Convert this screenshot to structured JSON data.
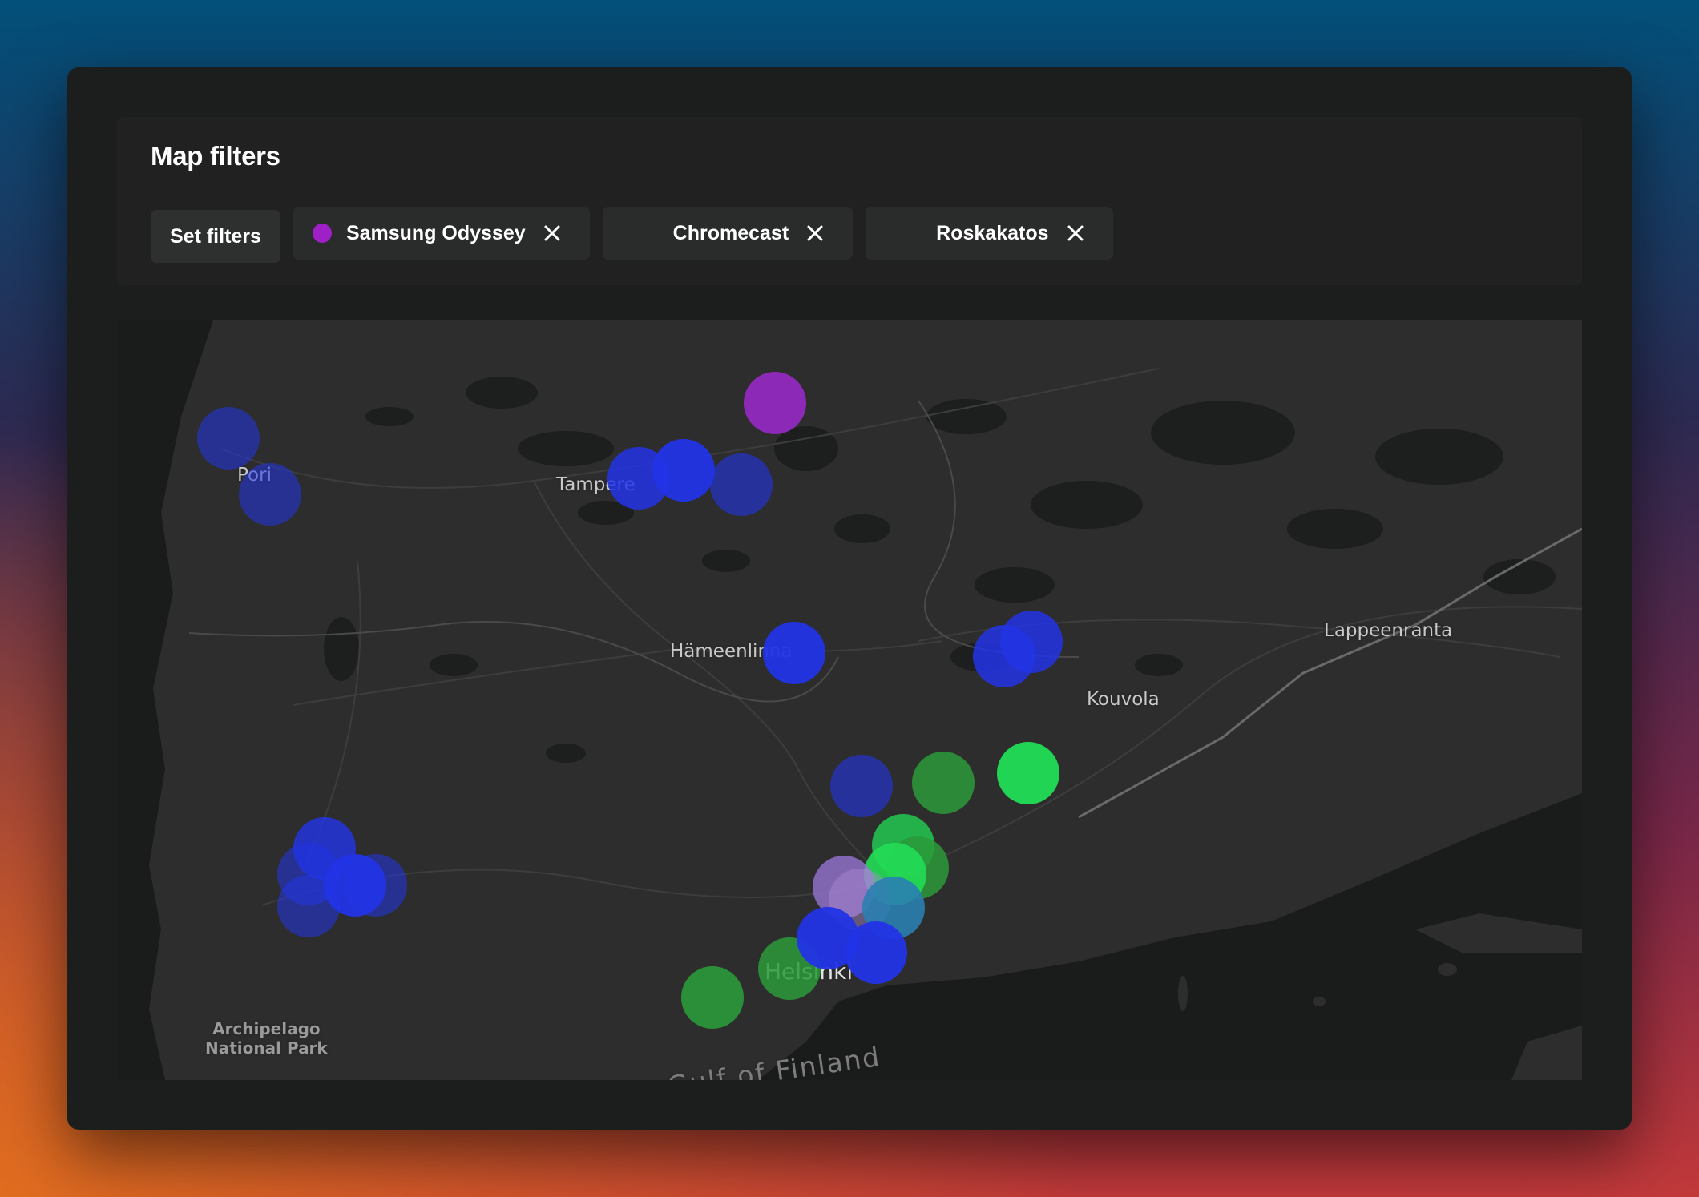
{
  "panel": {
    "title": "Map filters",
    "set_filters_label": "Set filters"
  },
  "filters": [
    {
      "label": "Samsung Odyssey",
      "color": "#a020c8",
      "show_dot": true
    },
    {
      "label": "Chromecast",
      "color": null,
      "show_dot": false
    },
    {
      "label": "Roskakatos",
      "color": null,
      "show_dot": false
    }
  ],
  "map": {
    "places": {
      "pori": "Pori",
      "tampere": "Tampere",
      "hameenlinna": "Hämeenlinna",
      "lappeenranta": "Lappeenranta",
      "kouvola": "Kouvola",
      "helsinki": "Helsinki",
      "park": "Archipelago\nNational Park",
      "sea": "Gulf of Finland"
    },
    "marker_colors": {
      "blue": "#2234e6",
      "purple": "#9c2ad0",
      "green_light": "#22dd55",
      "green_dark": "#2a9a3a",
      "teal": "#2a7fb0"
    }
  }
}
